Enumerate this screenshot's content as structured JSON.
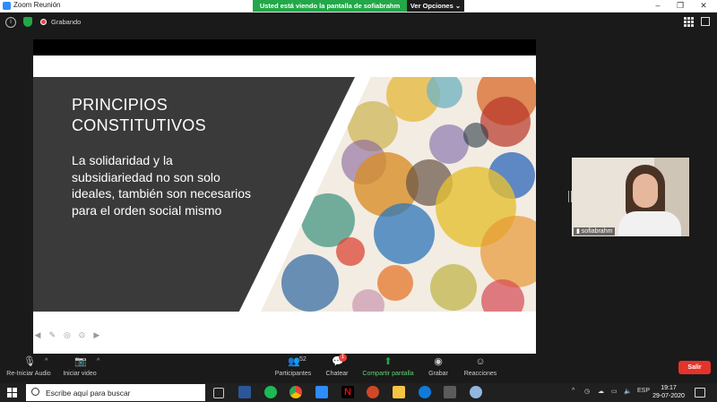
{
  "window": {
    "title": "Zoom Reunión",
    "controls": [
      "minimize",
      "maximize",
      "close"
    ]
  },
  "share_banner": {
    "message": "Usted está viendo la pantalla de sofiabrahm",
    "options_label": "Ver Opciones",
    "options_chevron": "chevron-down-icon"
  },
  "meeting_bar": {
    "recording_label": "Grabando"
  },
  "slide": {
    "title_line1": "PRINCIPIOS",
    "title_line2": "CONSTITUTIVOS",
    "body": "La solidaridad y la subsidiariedad no son solo ideales, también son necesarios para el orden social mismo"
  },
  "participant": {
    "name": "sofiabrahm"
  },
  "toolbar": {
    "audio_label": "Re-Iniciar Audio",
    "video_label": "Iniciar video",
    "participants_label": "Participantes",
    "participants_count": "52",
    "chat_label": "Chatear",
    "chat_badge": "1",
    "share_label": "Compartir pantalla",
    "record_label": "Grabar",
    "reactions_label": "Reacciones",
    "leave_label": "Salir"
  },
  "colors": {
    "share_green": "#22a848",
    "leave_red": "#e5332a",
    "slide_dark": "#3a3a3a",
    "zoom_blue": "#2d8cff"
  },
  "taskbar": {
    "search_placeholder": "Escribe aquí para buscar",
    "language": "ESP",
    "time": "19:17",
    "date": "29-07-2020",
    "apps": [
      "task-view-icon",
      "word-icon",
      "spotify-icon",
      "chrome-icon",
      "zoom-icon",
      "netflix-icon",
      "powerpoint-icon",
      "file-explorer-icon",
      "edge-icon",
      "store-icon",
      "paint-icon"
    ]
  }
}
